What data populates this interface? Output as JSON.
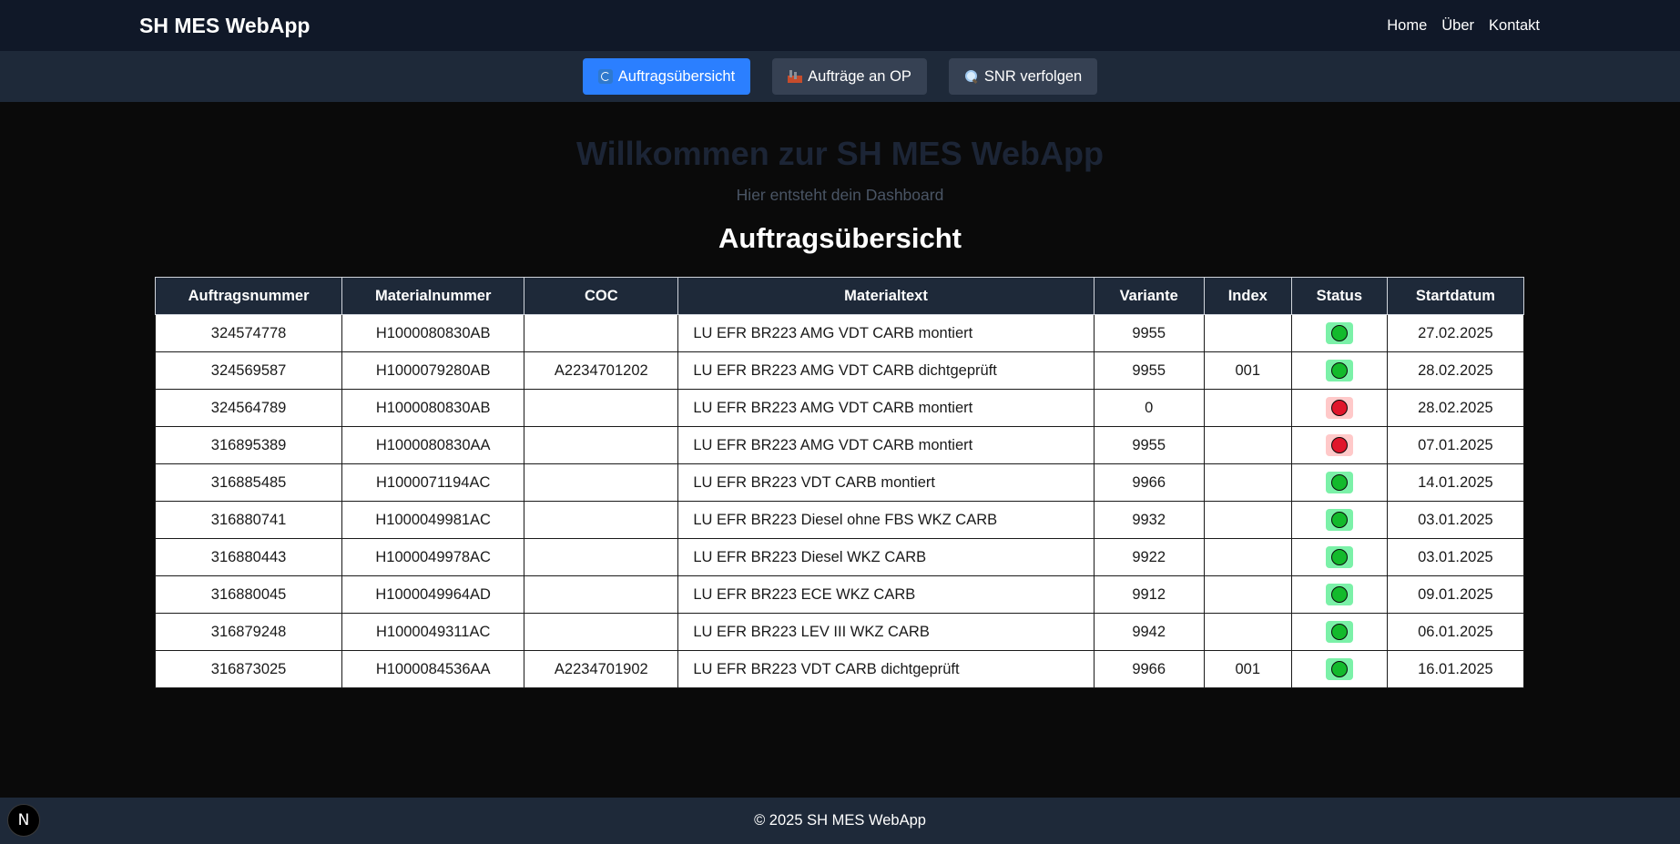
{
  "header": {
    "brand": "SH MES WebApp",
    "nav": [
      "Home",
      "Über",
      "Kontakt"
    ]
  },
  "subnav": {
    "buttons": [
      {
        "label": "Auftragsübersicht",
        "icon": "refresh-icon",
        "active": true
      },
      {
        "label": "Aufträge an OP",
        "icon": "factory-icon",
        "active": false
      },
      {
        "label": "SNR verfolgen",
        "icon": "magnifier-icon",
        "active": false
      }
    ]
  },
  "hero": {
    "title": "Willkommen zur SH MES WebApp",
    "subtitle": "Hier entsteht dein Dashboard"
  },
  "orders": {
    "title": "Auftragsübersicht",
    "columns": [
      "Auftragsnummer",
      "Materialnummer",
      "COC",
      "Materialtext",
      "Variante",
      "Index",
      "Status",
      "Startdatum"
    ],
    "rows": [
      {
        "order": "324574778",
        "material": "H1000080830AB",
        "coc": "",
        "text": "LU EFR BR223 AMG VDT CARB montiert",
        "variant": "9955",
        "index": "",
        "status": "ok",
        "start": "27.02.2025"
      },
      {
        "order": "324569587",
        "material": "H1000079280AB",
        "coc": "A2234701202",
        "text": "LU EFR BR223 AMG VDT CARB dichtgeprüft",
        "variant": "9955",
        "index": "001",
        "status": "ok",
        "start": "28.02.2025"
      },
      {
        "order": "324564789",
        "material": "H1000080830AB",
        "coc": "",
        "text": "LU EFR BR223 AMG VDT CARB montiert",
        "variant": "0",
        "index": "",
        "status": "error",
        "start": "28.02.2025"
      },
      {
        "order": "316895389",
        "material": "H1000080830AA",
        "coc": "",
        "text": "LU EFR BR223 AMG VDT CARB montiert",
        "variant": "9955",
        "index": "",
        "status": "error",
        "start": "07.01.2025"
      },
      {
        "order": "316885485",
        "material": "H1000071194AC",
        "coc": "",
        "text": "LU EFR BR223 VDT CARB montiert",
        "variant": "9966",
        "index": "",
        "status": "ok",
        "start": "14.01.2025"
      },
      {
        "order": "316880741",
        "material": "H1000049981AC",
        "coc": "",
        "text": "LU EFR BR223 Diesel ohne FBS WKZ CARB",
        "variant": "9932",
        "index": "",
        "status": "ok",
        "start": "03.01.2025"
      },
      {
        "order": "316880443",
        "material": "H1000049978AC",
        "coc": "",
        "text": "LU EFR BR223 Diesel WKZ CARB",
        "variant": "9922",
        "index": "",
        "status": "ok",
        "start": "03.01.2025"
      },
      {
        "order": "316880045",
        "material": "H1000049964AD",
        "coc": "",
        "text": "LU EFR BR223 ECE WKZ CARB",
        "variant": "9912",
        "index": "",
        "status": "ok",
        "start": "09.01.2025"
      },
      {
        "order": "316879248",
        "material": "H1000049311AC",
        "coc": "",
        "text": "LU EFR BR223 LEV III WKZ CARB",
        "variant": "9942",
        "index": "",
        "status": "ok",
        "start": "06.01.2025"
      },
      {
        "order": "316873025",
        "material": "H1000084536AA",
        "coc": "A2234701902",
        "text": "LU EFR BR223 VDT CARB dichtgeprüft",
        "variant": "9966",
        "index": "001",
        "status": "ok",
        "start": "16.01.2025"
      }
    ]
  },
  "footer": {
    "text": "© 2025 SH MES WebApp"
  },
  "dev_badge": {
    "label": "N"
  },
  "colors": {
    "background": "#0a0a0a",
    "topbar": "#101828",
    "subnav": "#1e2939",
    "accent": "#2b7fff",
    "status_ok": "#13ba2c",
    "status_error": "#e0162b"
  }
}
